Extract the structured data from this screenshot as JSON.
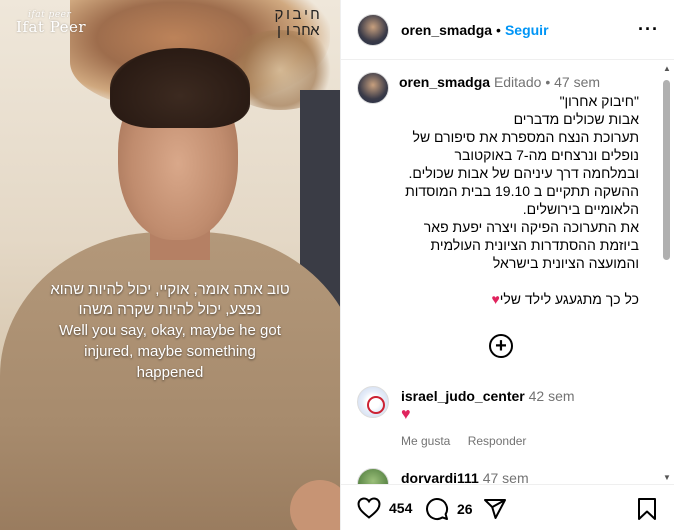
{
  "media": {
    "watermark": "Ifat Peer",
    "watermark_signature": "ifat peer",
    "title_he_line1": "חיבוק",
    "title_he_line2": "אחרון",
    "subtitle_he_line1": "טוב אתה אומר, אוקיי, יכול להיות שהוא",
    "subtitle_he_line2": "נפצע, יכול להיות שקרה משהו",
    "subtitle_en_line1": "Well you say, okay, maybe he got",
    "subtitle_en_line2": "injured, maybe something",
    "subtitle_en_line3": "happened"
  },
  "header": {
    "username": "oren_smadga",
    "separator": "•",
    "follow_label": "Seguir",
    "more_icon": "more-horizontal-icon"
  },
  "caption": {
    "username": "oren_smadga",
    "edited_label": "Editado",
    "separator": "•",
    "time": "47 sem",
    "lines": [
      "\"חיבוק אחרון\"",
      "אבות שכולים מדברים",
      "תערוכת הנצח המספרת את סיפורם של",
      "נופלים ונרצחים מה-7 באוקטובר",
      "ובמלחמה דרך עיניהם של אבות שכולים.",
      "ההשקה תתקיים ב 19.10 בבית המוסדות",
      "הלאומיים בירושלים.",
      "את התערוכה הפיקה ויצרה יפעת פאר",
      "ביוזמת ההסתדרות הציונית העולמית",
      "והמועצה הציונית בישראל",
      "",
      "כל כך מתגעגע לילד שלי"
    ],
    "last_line_heart": "♥"
  },
  "load_more_icon": "plus-circle-icon",
  "comments": [
    {
      "username": "israel_judo_center",
      "time": "42 sem",
      "text": "♥",
      "like_label": "Me gusta",
      "reply_label": "Responder"
    },
    {
      "username": "dorvardi111",
      "time": "47 sem"
    }
  ],
  "actions": {
    "likes": "454",
    "comments": "26"
  },
  "colors": {
    "accent": "#0095f6",
    "heart": "#e0245e",
    "muted": "#737373"
  }
}
